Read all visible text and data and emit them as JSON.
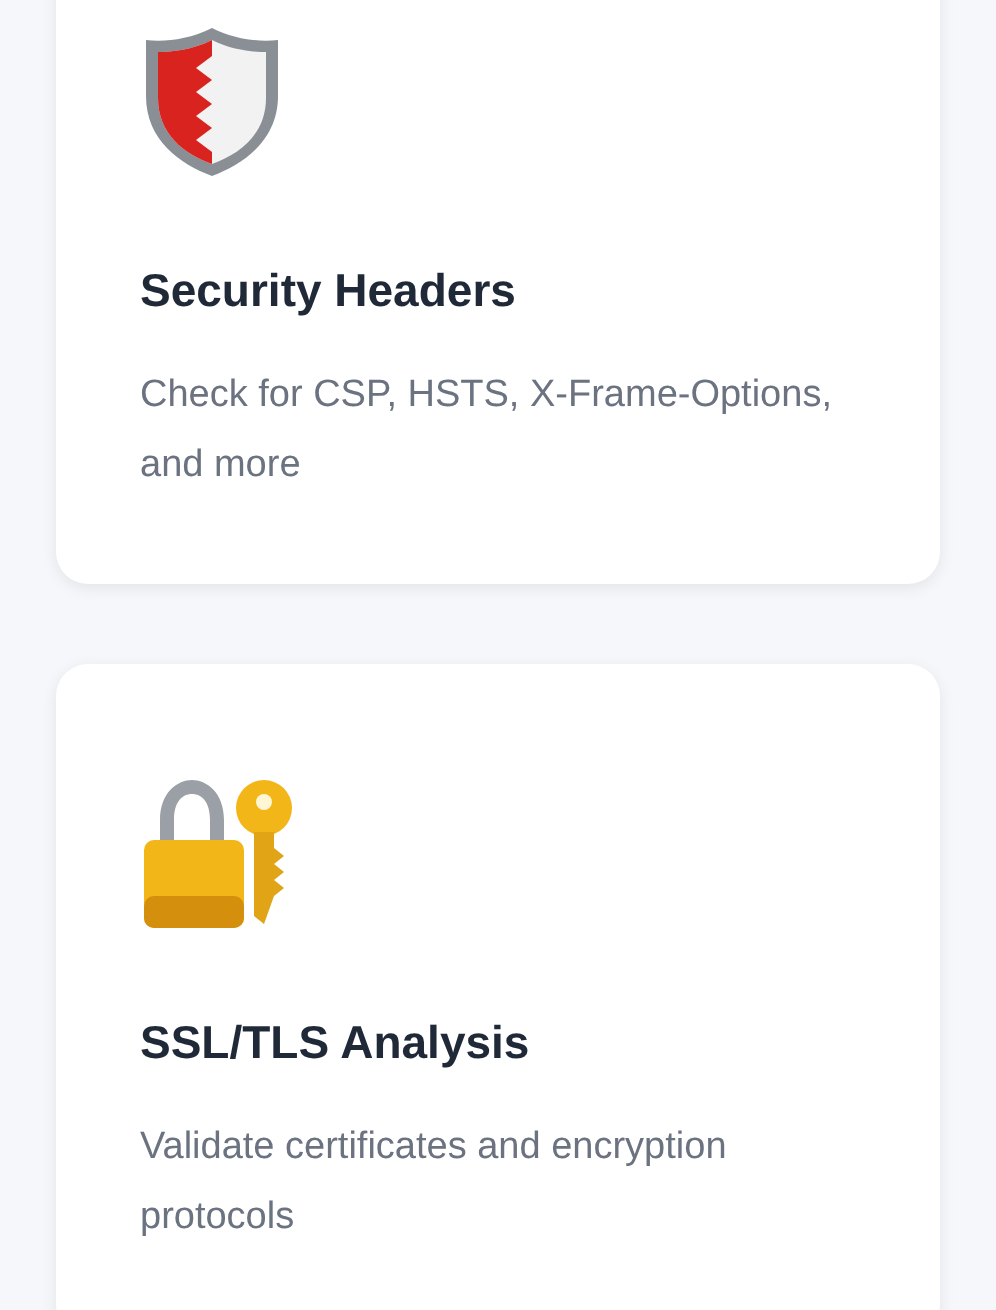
{
  "cards": [
    {
      "kind": "shield",
      "title": "Security Headers",
      "description": "Check for CSP, HSTS, X-Frame-Options, and more"
    },
    {
      "kind": "lock",
      "title": "SSL/TLS Analysis",
      "description": "Validate certificates and encryption protocols"
    }
  ]
}
